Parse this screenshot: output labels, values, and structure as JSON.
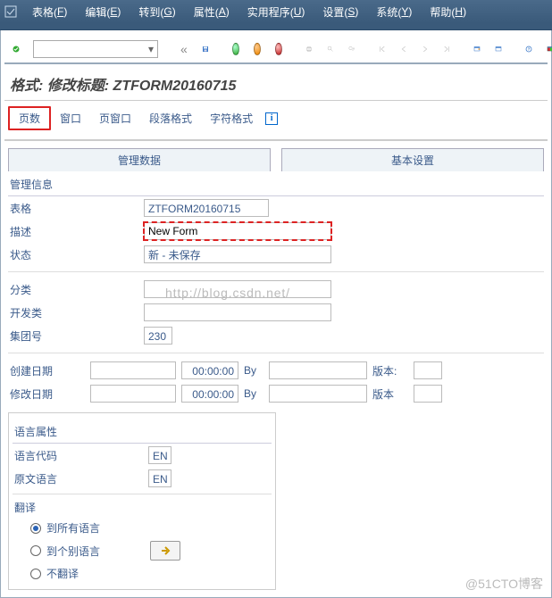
{
  "menu": {
    "items": [
      {
        "label": "表格(F)",
        "u": "F"
      },
      {
        "label": "编辑(E)",
        "u": "E"
      },
      {
        "label": "转到(G)",
        "u": "G"
      },
      {
        "label": "属性(A)",
        "u": "A"
      },
      {
        "label": "实用程序(U)",
        "u": "U"
      },
      {
        "label": "设置(S)",
        "u": "S"
      },
      {
        "label": "系统(Y)",
        "u": "Y"
      },
      {
        "label": "帮助(H)",
        "u": "H"
      }
    ]
  },
  "title": "格式: 修改标题: ZTFORM20160715",
  "subtabs": [
    "页数",
    "窗口",
    "页窗口",
    "段落格式",
    "字符格式"
  ],
  "subtab_active": 0,
  "bigtabs": {
    "left": "管理数据",
    "right": "基本设置"
  },
  "group_admin": "管理信息",
  "fields": {
    "table_lbl": "表格",
    "table_val": "ZTFORM20160715",
    "desc_lbl": "描述",
    "desc_val": "New Form",
    "status_lbl": "状态",
    "status_val": "新 - 未保存",
    "cat_lbl": "分类",
    "cat_val": "",
    "devclass_lbl": "开发类",
    "devclass_val": "",
    "client_lbl": "集团号",
    "client_val": "230",
    "created_lbl": "创建日期",
    "created_time": "00:00:00",
    "created_by_lbl": "By",
    "created_by": "",
    "version_lbl_colon": "版本:",
    "version_val": "",
    "changed_lbl": "修改日期",
    "changed_time": "00:00:00",
    "changed_by_lbl": "By",
    "changed_by": "",
    "version_lbl": "版本",
    "version_val2": ""
  },
  "lang": {
    "group": "语言属性",
    "code_lbl": "语言代码",
    "code_val": "EN",
    "orig_lbl": "原文语言",
    "orig_val": "EN",
    "trans_lbl": "翻译",
    "opt_all": "到所有语言",
    "opt_sel": "到个别语言",
    "opt_none": "不翻译"
  },
  "watermark_url": "http://blog.csdn.net/",
  "watermark_br": "@51CTO博客"
}
